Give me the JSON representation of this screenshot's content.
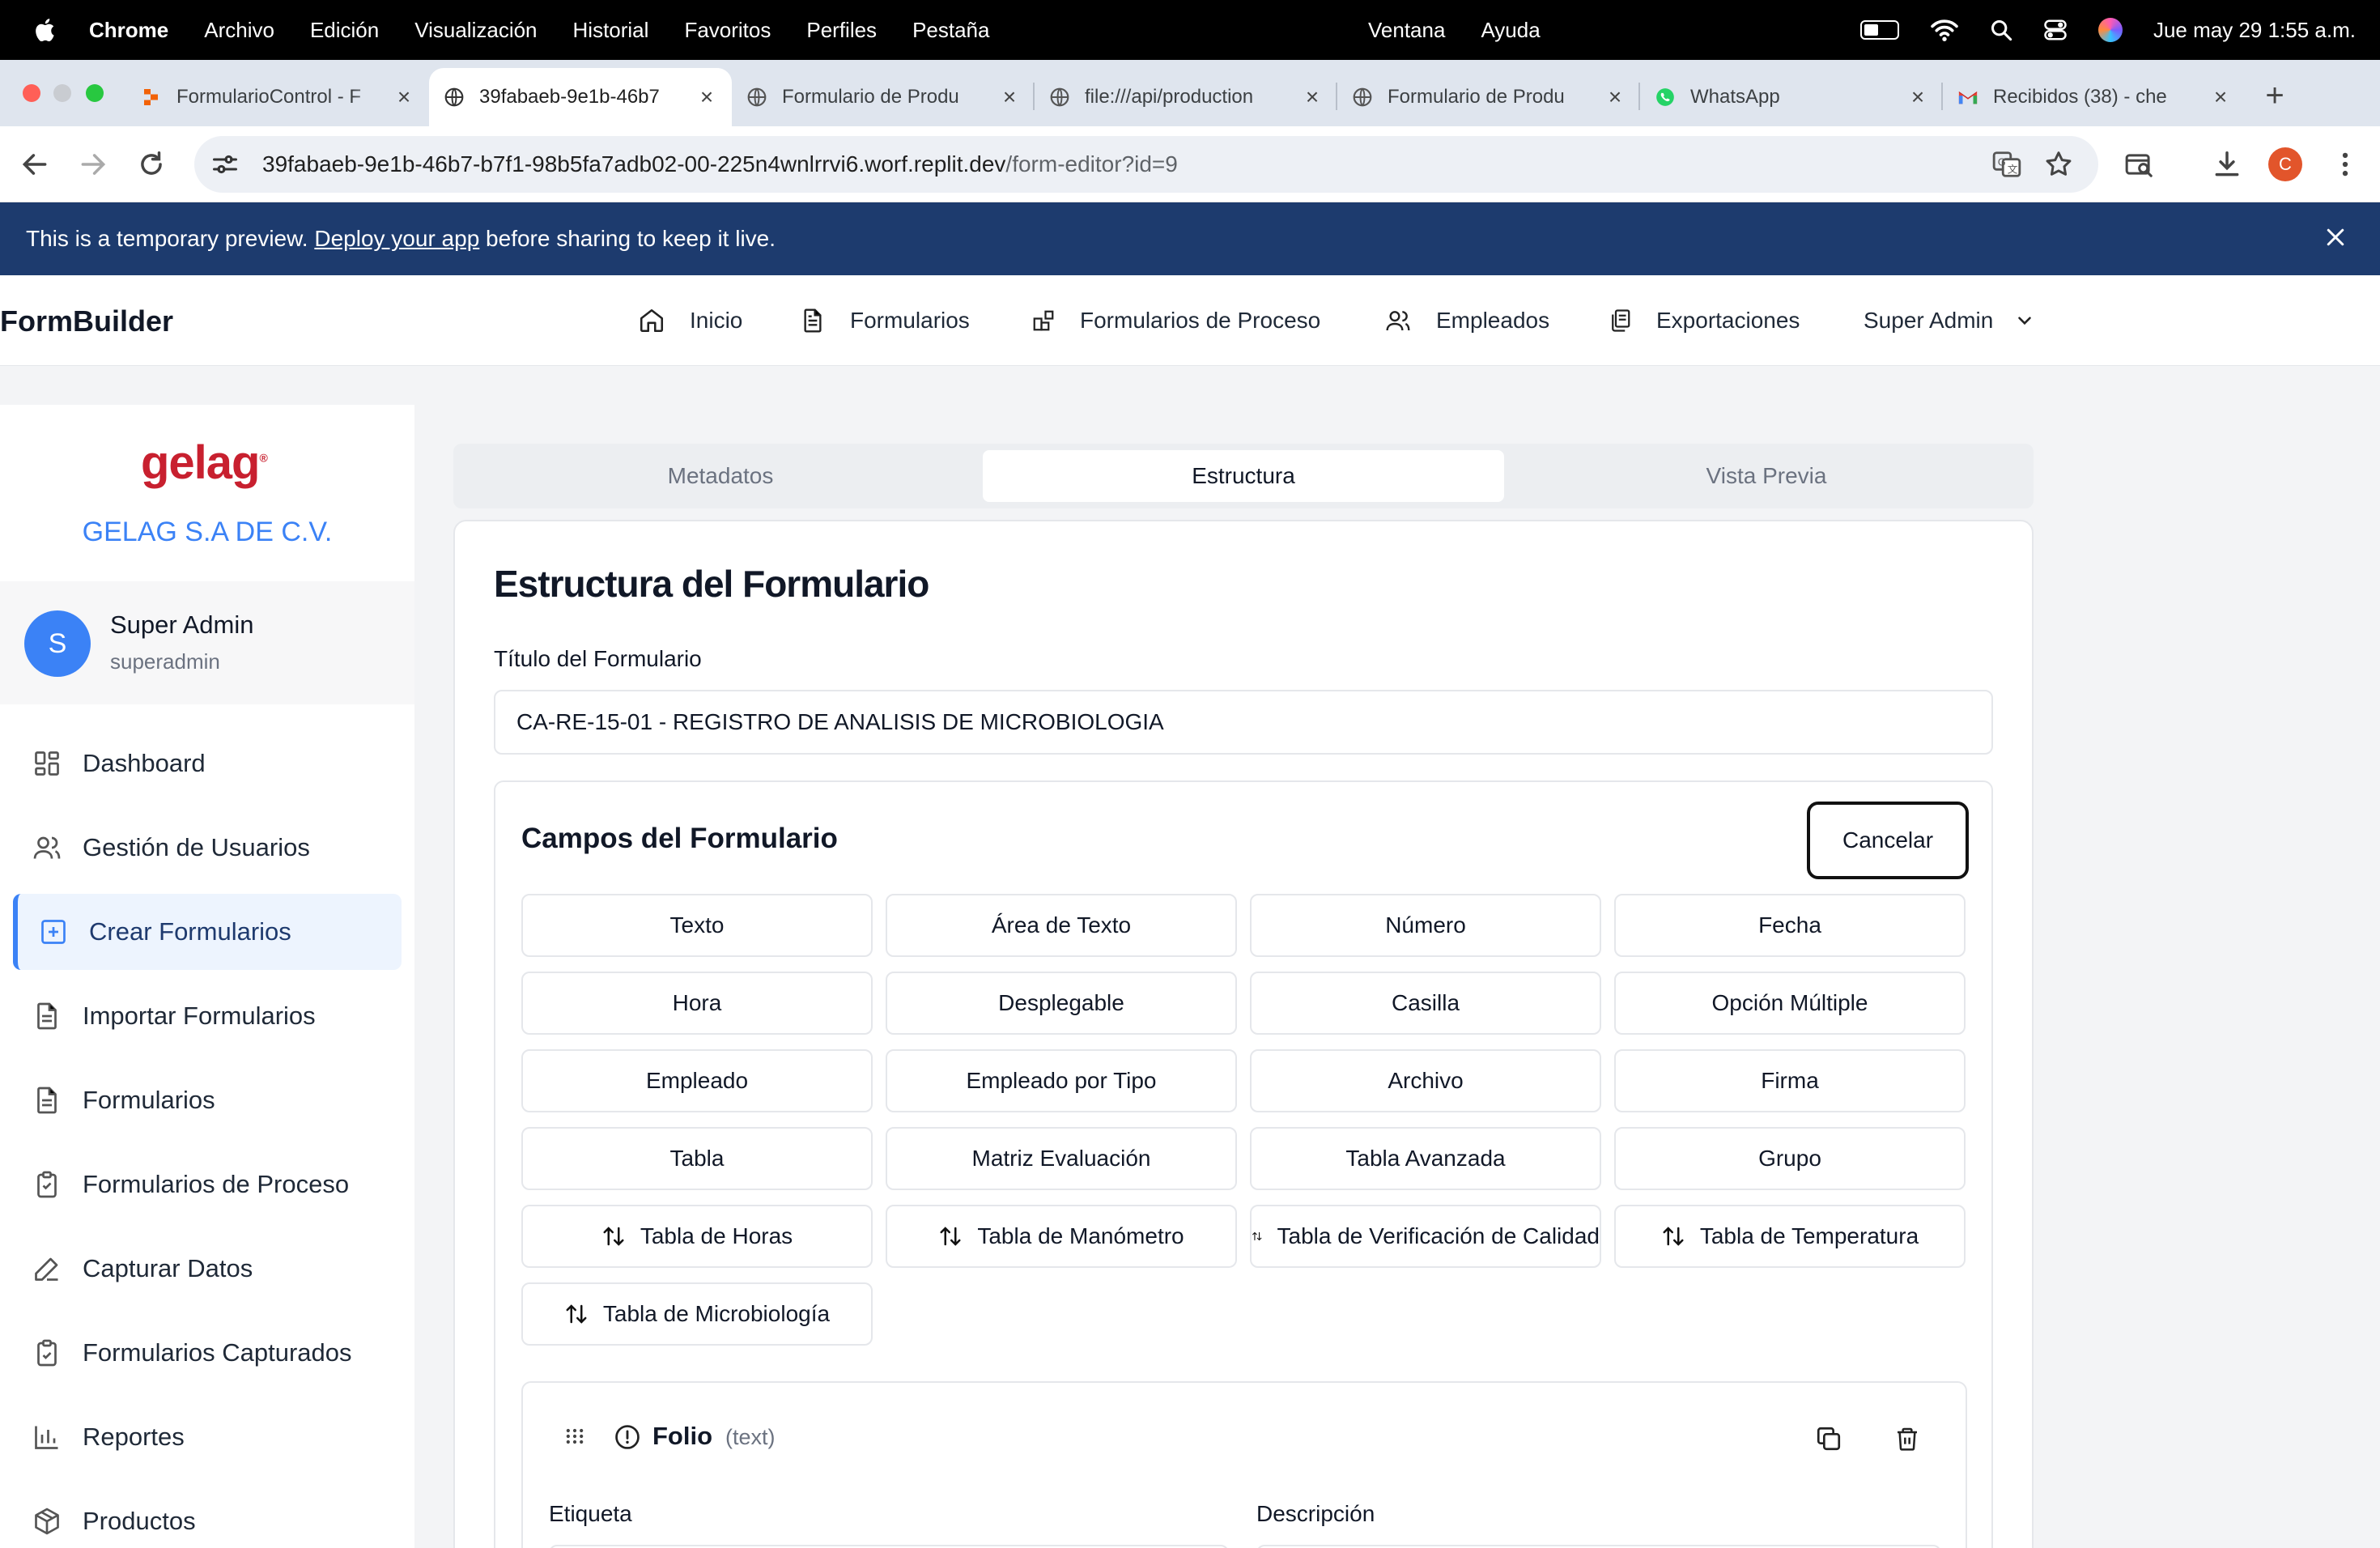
{
  "os_menubar": {
    "app": "Chrome",
    "menus": [
      "Archivo",
      "Edición",
      "Visualización",
      "Historial",
      "Favoritos",
      "Perfiles",
      "Pestaña"
    ],
    "center_menus": [
      "Ventana",
      "Ayuda"
    ],
    "datetime": "Jue may 29  1:55 a.m."
  },
  "browser": {
    "tabs": [
      {
        "title": "FormularioControl - F",
        "icon": "replit-icon"
      },
      {
        "title": "39fabaeb-9e1b-46b7",
        "icon": "globe-icon"
      },
      {
        "title": "Formulario de Produ",
        "icon": "globe-icon"
      },
      {
        "title": "file:///api/production",
        "icon": "globe-icon"
      },
      {
        "title": "Formulario de Produ",
        "icon": "globe-icon"
      },
      {
        "title": "WhatsApp",
        "icon": "whatsapp-icon"
      },
      {
        "title": "Recibidos (38) - che",
        "icon": "gmail-icon"
      }
    ],
    "url_host": "39fabaeb-9e1b-46b7-b7f1-98b5fa7adb02-00-225n4wnlrrvi6.worf.replit.dev",
    "url_path": "/form-editor?id=9",
    "profile_initial": "C"
  },
  "banner": {
    "prefix": "This is a temporary preview. ",
    "link": "Deploy your app",
    "suffix": " before sharing to keep it live."
  },
  "header": {
    "brand": "FormBuilder",
    "nav": [
      "Inicio",
      "Formularios",
      "Formularios de Proceso",
      "Empleados",
      "Exportaciones"
    ],
    "user_menu": "Super Admin"
  },
  "sidebar": {
    "logo": "gelag",
    "company": "GELAG S.A DE C.V.",
    "user": {
      "initial": "S",
      "name": "Super Admin",
      "login": "superadmin"
    },
    "items": [
      {
        "label": "Dashboard",
        "icon": "dashboard-icon"
      },
      {
        "label": "Gestión de Usuarios",
        "icon": "users-icon"
      },
      {
        "label": "Crear Formularios",
        "icon": "plus-square-icon"
      },
      {
        "label": "Importar Formularios",
        "icon": "file-icon"
      },
      {
        "label": "Formularios",
        "icon": "file-icon"
      },
      {
        "label": "Formularios de Proceso",
        "icon": "clipboard-icon"
      },
      {
        "label": "Capturar Datos",
        "icon": "pen-icon"
      },
      {
        "label": "Formularios Capturados",
        "icon": "clipboard-check-icon"
      },
      {
        "label": "Reportes",
        "icon": "bar-chart-icon"
      },
      {
        "label": "Productos",
        "icon": "package-icon"
      }
    ]
  },
  "editor": {
    "tabs": [
      "Metadatos",
      "Estructura",
      "Vista Previa"
    ],
    "heading": "Estructura del Formulario",
    "title_label": "Título del Formulario",
    "title_value": "CA-RE-15-01 - REGISTRO DE ANALISIS DE MICROBIOLOGIA",
    "fields_heading": "Campos del Formulario",
    "cancel_label": "Cancelar",
    "field_types": [
      "Texto",
      "Área de Texto",
      "Número",
      "Fecha",
      "Hora",
      "Desplegable",
      "Casilla",
      "Opción Múltiple",
      "Empleado",
      "Empleado por Tipo",
      "Archivo",
      "Firma",
      "Tabla",
      "Matriz Evaluación",
      "Tabla Avanzada",
      "Grupo"
    ],
    "special_types": [
      "Tabla de Horas",
      "Tabla de Manómetro",
      "Tabla de Verificación de Calidad",
      "Tabla de Temperatura",
      "Tabla de Microbiología"
    ],
    "field": {
      "name": "Folio",
      "type": "(text)",
      "label_caption": "Etiqueta",
      "description_caption": "Descripción"
    }
  }
}
